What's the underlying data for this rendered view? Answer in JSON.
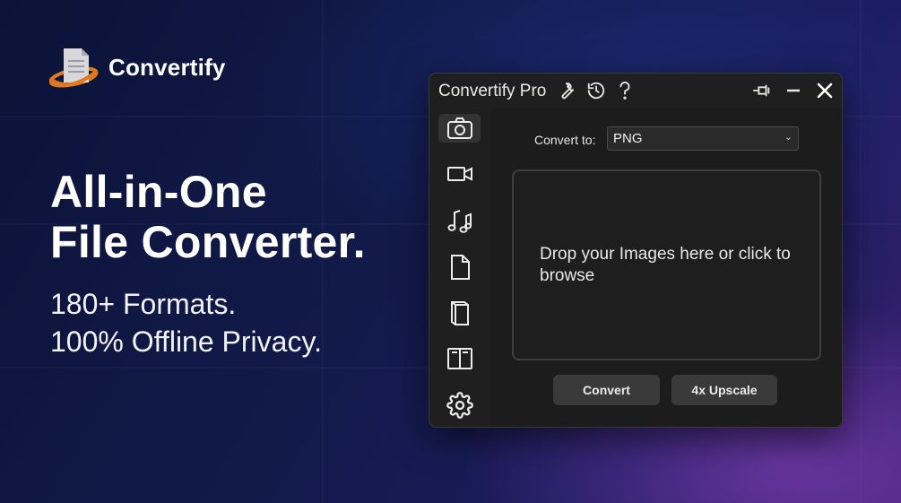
{
  "brand": {
    "name": "Convertify"
  },
  "hero": {
    "headline_line1": "All-in-One",
    "headline_line2": "File Converter.",
    "sub_line1": "180+ Formats.",
    "sub_line2": "100% Offline Privacy."
  },
  "window": {
    "title": "Convertify Pro",
    "title_icons": [
      "wrench-icon",
      "history-icon",
      "help-icon"
    ],
    "controls": [
      "pin-icon",
      "minimize-icon",
      "close-icon"
    ],
    "sidebar": [
      {
        "name": "camera-icon",
        "active": true
      },
      {
        "name": "video-icon",
        "active": false
      },
      {
        "name": "music-icon",
        "active": false
      },
      {
        "name": "document-icon",
        "active": false
      },
      {
        "name": "book-icon",
        "active": false
      },
      {
        "name": "open-book-icon",
        "active": false
      },
      {
        "name": "gear-icon",
        "active": false
      }
    ],
    "convert_label": "Convert to:",
    "format_selected": "PNG",
    "dropzone_text": "Drop your Images here or click to browse",
    "convert_button": "Convert",
    "upscale_button": "4x Upscale"
  },
  "colors": {
    "accent_orange": "#e0781e",
    "window_bg": "#1f1f1f",
    "button_bg": "#3a3a3a"
  }
}
